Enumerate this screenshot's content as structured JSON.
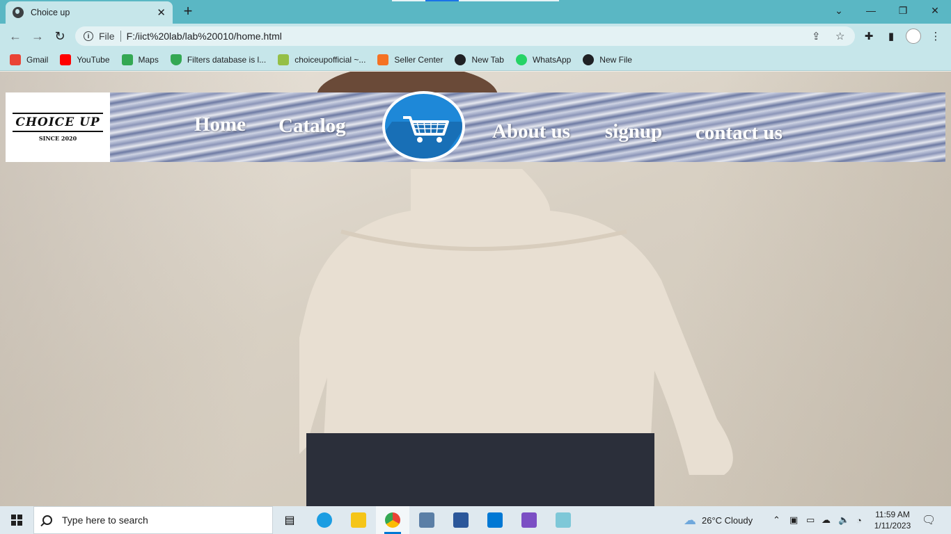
{
  "browser": {
    "tab_title": "Choice up",
    "tab_close": "✕",
    "new_tab": "+",
    "url_scheme": "File",
    "url": "F:/iict%20lab/lab%20010/home.html",
    "window_controls": {
      "minimize": "—",
      "restore": "❐",
      "close": "✕",
      "tabsearch": "⌄"
    }
  },
  "bookmarks": [
    {
      "label": "Gmail",
      "icon": "gmail-icon",
      "color": "#ea4335"
    },
    {
      "label": "YouTube",
      "icon": "youtube-icon",
      "color": "#ff0000"
    },
    {
      "label": "Maps",
      "icon": "maps-icon",
      "color": "#34a853"
    },
    {
      "label": "Filters database is l...",
      "icon": "shield-icon",
      "color": "#34a853"
    },
    {
      "label": "choiceupofficial ~...",
      "icon": "shopify-icon",
      "color": "#95bf47"
    },
    {
      "label": "Seller Center",
      "icon": "seller-center-icon",
      "color": "#f57224"
    },
    {
      "label": "New Tab",
      "icon": "globe-icon",
      "color": "#202124"
    },
    {
      "label": "WhatsApp",
      "icon": "whatsapp-icon",
      "color": "#25d366"
    },
    {
      "label": "New File",
      "icon": "github-icon",
      "color": "#202124"
    }
  ],
  "site": {
    "logo_title": "CHOICE UP",
    "logo_sub": "SINCE 2020",
    "nav": {
      "home": "Home",
      "catalog": "Catalog",
      "about": "About us",
      "signup": "signup",
      "contact": "contact us"
    }
  },
  "taskbar": {
    "search_placeholder": "Type here to search",
    "weather": "26°C  Cloudy",
    "time": "11:59 AM",
    "date": "1/11/2023"
  },
  "colors": {
    "tabstrip": "#5ab7c4",
    "toolbar": "#c6e6ea",
    "cart_blue": "#1e88d8"
  }
}
